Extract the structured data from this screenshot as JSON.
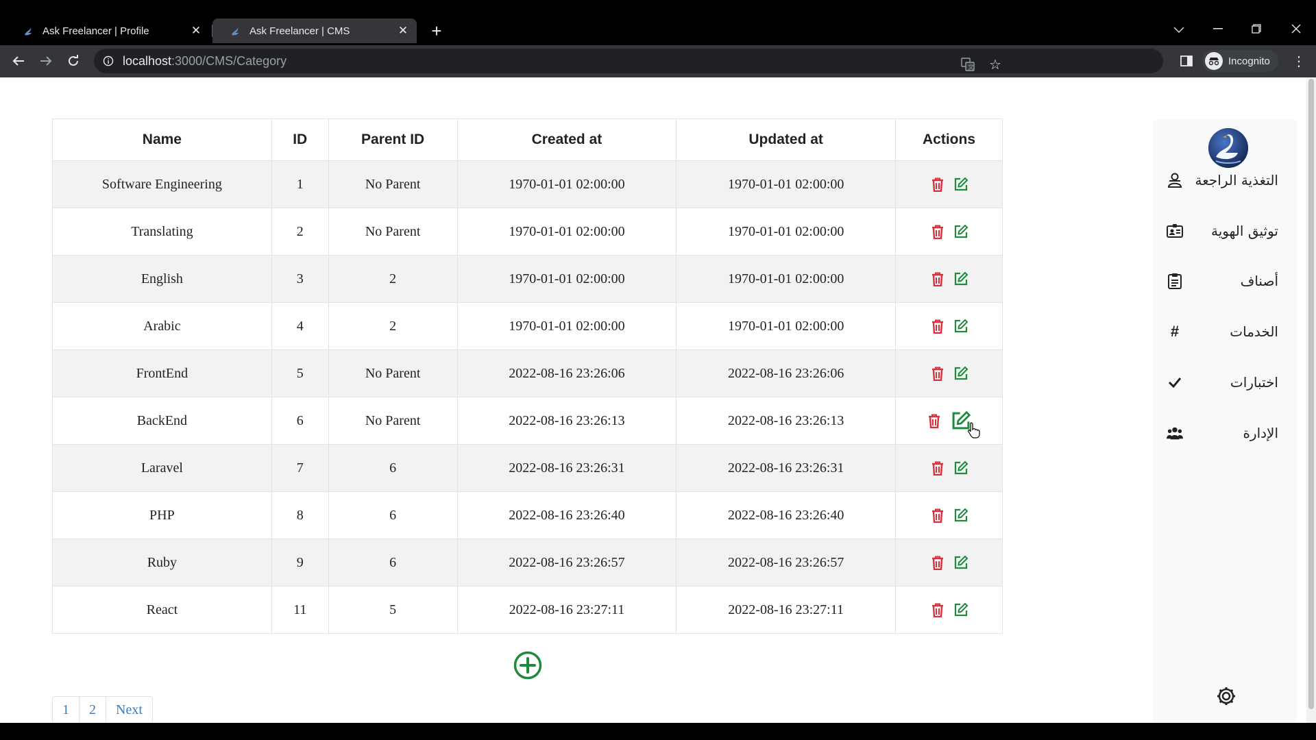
{
  "browser": {
    "tabs": [
      {
        "title": "Ask Freelancer | Profile",
        "active": false
      },
      {
        "title": "Ask Freelancer | CMS",
        "active": true
      }
    ],
    "url_host": "localhost",
    "url_path": ":3000/CMS/Category",
    "profile_label": "Incognito"
  },
  "table": {
    "headers": [
      "Name",
      "ID",
      "Parent ID",
      "Created at",
      "Updated at",
      "Actions"
    ],
    "rows": [
      {
        "name": "Software Engineering",
        "id": "1",
        "parent": "No Parent",
        "created": "1970-01-01 02:00:00",
        "updated": "1970-01-01 02:00:00"
      },
      {
        "name": "Translating",
        "id": "2",
        "parent": "No Parent",
        "created": "1970-01-01 02:00:00",
        "updated": "1970-01-01 02:00:00"
      },
      {
        "name": "English",
        "id": "3",
        "parent": "2",
        "created": "1970-01-01 02:00:00",
        "updated": "1970-01-01 02:00:00"
      },
      {
        "name": "Arabic",
        "id": "4",
        "parent": "2",
        "created": "1970-01-01 02:00:00",
        "updated": "1970-01-01 02:00:00"
      },
      {
        "name": "FrontEnd",
        "id": "5",
        "parent": "No Parent",
        "created": "2022-08-16 23:26:06",
        "updated": "2022-08-16 23:26:06"
      },
      {
        "name": "BackEnd",
        "id": "6",
        "parent": "No Parent",
        "created": "2022-08-16 23:26:13",
        "updated": "2022-08-16 23:26:13"
      },
      {
        "name": "Laravel",
        "id": "7",
        "parent": "6",
        "created": "2022-08-16 23:26:31",
        "updated": "2022-08-16 23:26:31"
      },
      {
        "name": "PHP",
        "id": "8",
        "parent": "6",
        "created": "2022-08-16 23:26:40",
        "updated": "2022-08-16 23:26:40"
      },
      {
        "name": "Ruby",
        "id": "9",
        "parent": "6",
        "created": "2022-08-16 23:26:57",
        "updated": "2022-08-16 23:26:57"
      },
      {
        "name": "React",
        "id": "11",
        "parent": "5",
        "created": "2022-08-16 23:27:11",
        "updated": "2022-08-16 23:27:11"
      }
    ]
  },
  "pagination": [
    "1",
    "2",
    "Next"
  ],
  "sidebar": {
    "items": [
      {
        "label": "التغذية الراجعة",
        "icon": "users-icon"
      },
      {
        "label": "توثيق الهوية",
        "icon": "id-card-icon"
      },
      {
        "label": "أصناف",
        "icon": "clipboard-icon"
      },
      {
        "label": "الخدمات",
        "icon": "hashtag-icon"
      },
      {
        "label": "اختبارات",
        "icon": "check-icon"
      },
      {
        "label": "الإدارة",
        "icon": "users-cog-icon"
      }
    ]
  },
  "colors": {
    "delete": "#d9303b",
    "edit": "#1d8a3c",
    "add": "#1d8a3c",
    "link": "#3a7cc1"
  }
}
